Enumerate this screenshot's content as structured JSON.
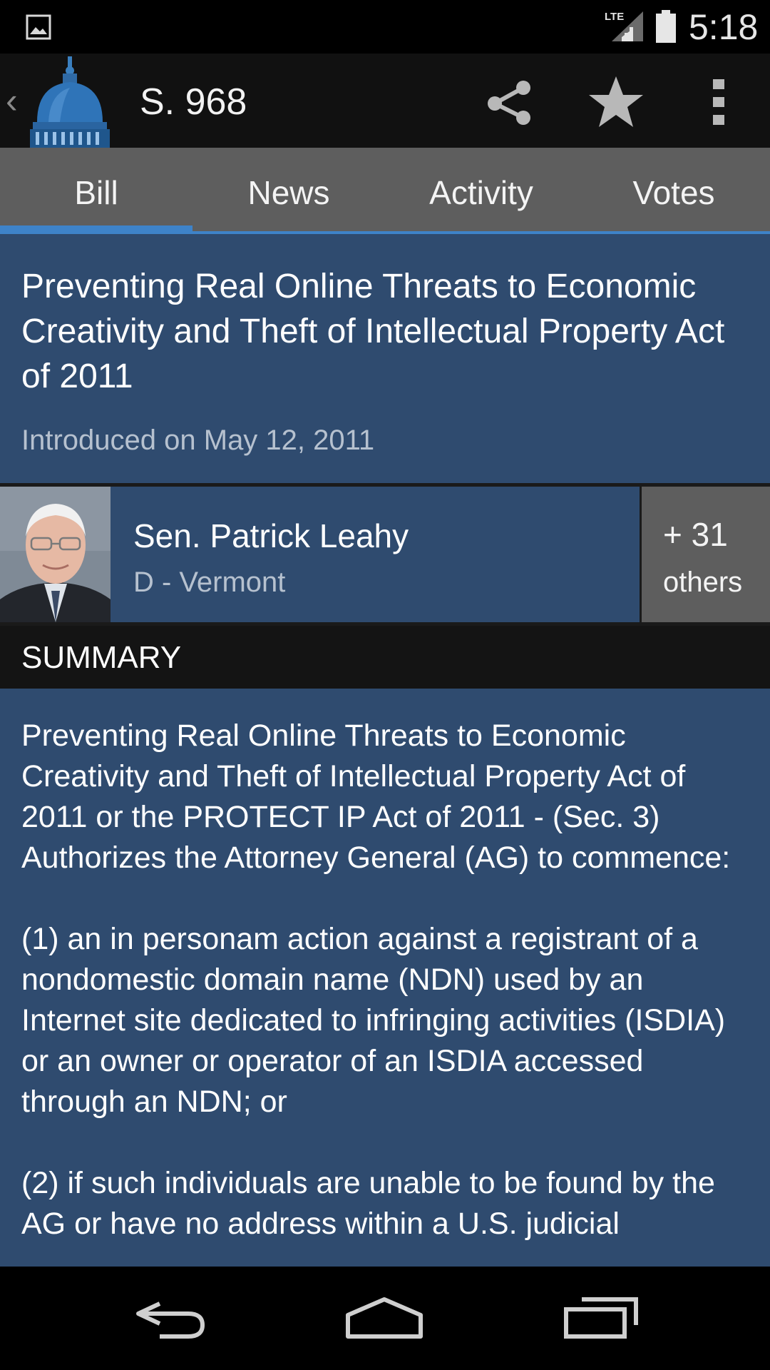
{
  "status_bar": {
    "time": "5:18",
    "network": "LTE",
    "icons": [
      "image-notification-icon",
      "lte-signal-icon",
      "battery-icon"
    ]
  },
  "action_bar": {
    "title": "S. 968",
    "icons": [
      "back-chevron-icon",
      "capitol-logo-icon",
      "share-icon",
      "star-icon",
      "overflow-menu-icon"
    ]
  },
  "tabs": [
    {
      "label": "Bill",
      "active": true
    },
    {
      "label": "News",
      "active": false
    },
    {
      "label": "Activity",
      "active": false
    },
    {
      "label": "Votes",
      "active": false
    }
  ],
  "bill": {
    "title": "Preventing Real Online Threats to Economic Creativity and Theft of Intellectual Property Act of 2011",
    "introduced": "Introduced on May 12, 2011"
  },
  "sponsor": {
    "name": "Sen. Patrick Leahy",
    "party_state": "D - Vermont",
    "others_count": "+ 31",
    "others_label": "others"
  },
  "summary": {
    "heading": "SUMMARY",
    "paragraphs": [
      "Preventing Real Online Threats to Economic Creativity and Theft of Intellectual Property Act of 2011 or the PROTECT IP Act of 2011 - (Sec. 3) Authorizes the Attorney General (AG) to commence:",
      "(1) an in personam action against a registrant of a nondomestic domain name (NDN) used by an Internet site dedicated to infringing activities (ISDIA) or an owner or operator of an ISDIA accessed through an NDN; or",
      "(2) if such individuals are unable to be found by the AG or have no address within a U.S. judicial"
    ]
  },
  "nav_bar": {
    "icons": [
      "back-nav-icon",
      "home-nav-icon",
      "recents-nav-icon"
    ]
  },
  "colors": {
    "content_blue": "#2f4b6f",
    "tab_gray": "#5e5e5e",
    "accent_blue": "#3e83c9",
    "action_bar": "#111111"
  }
}
